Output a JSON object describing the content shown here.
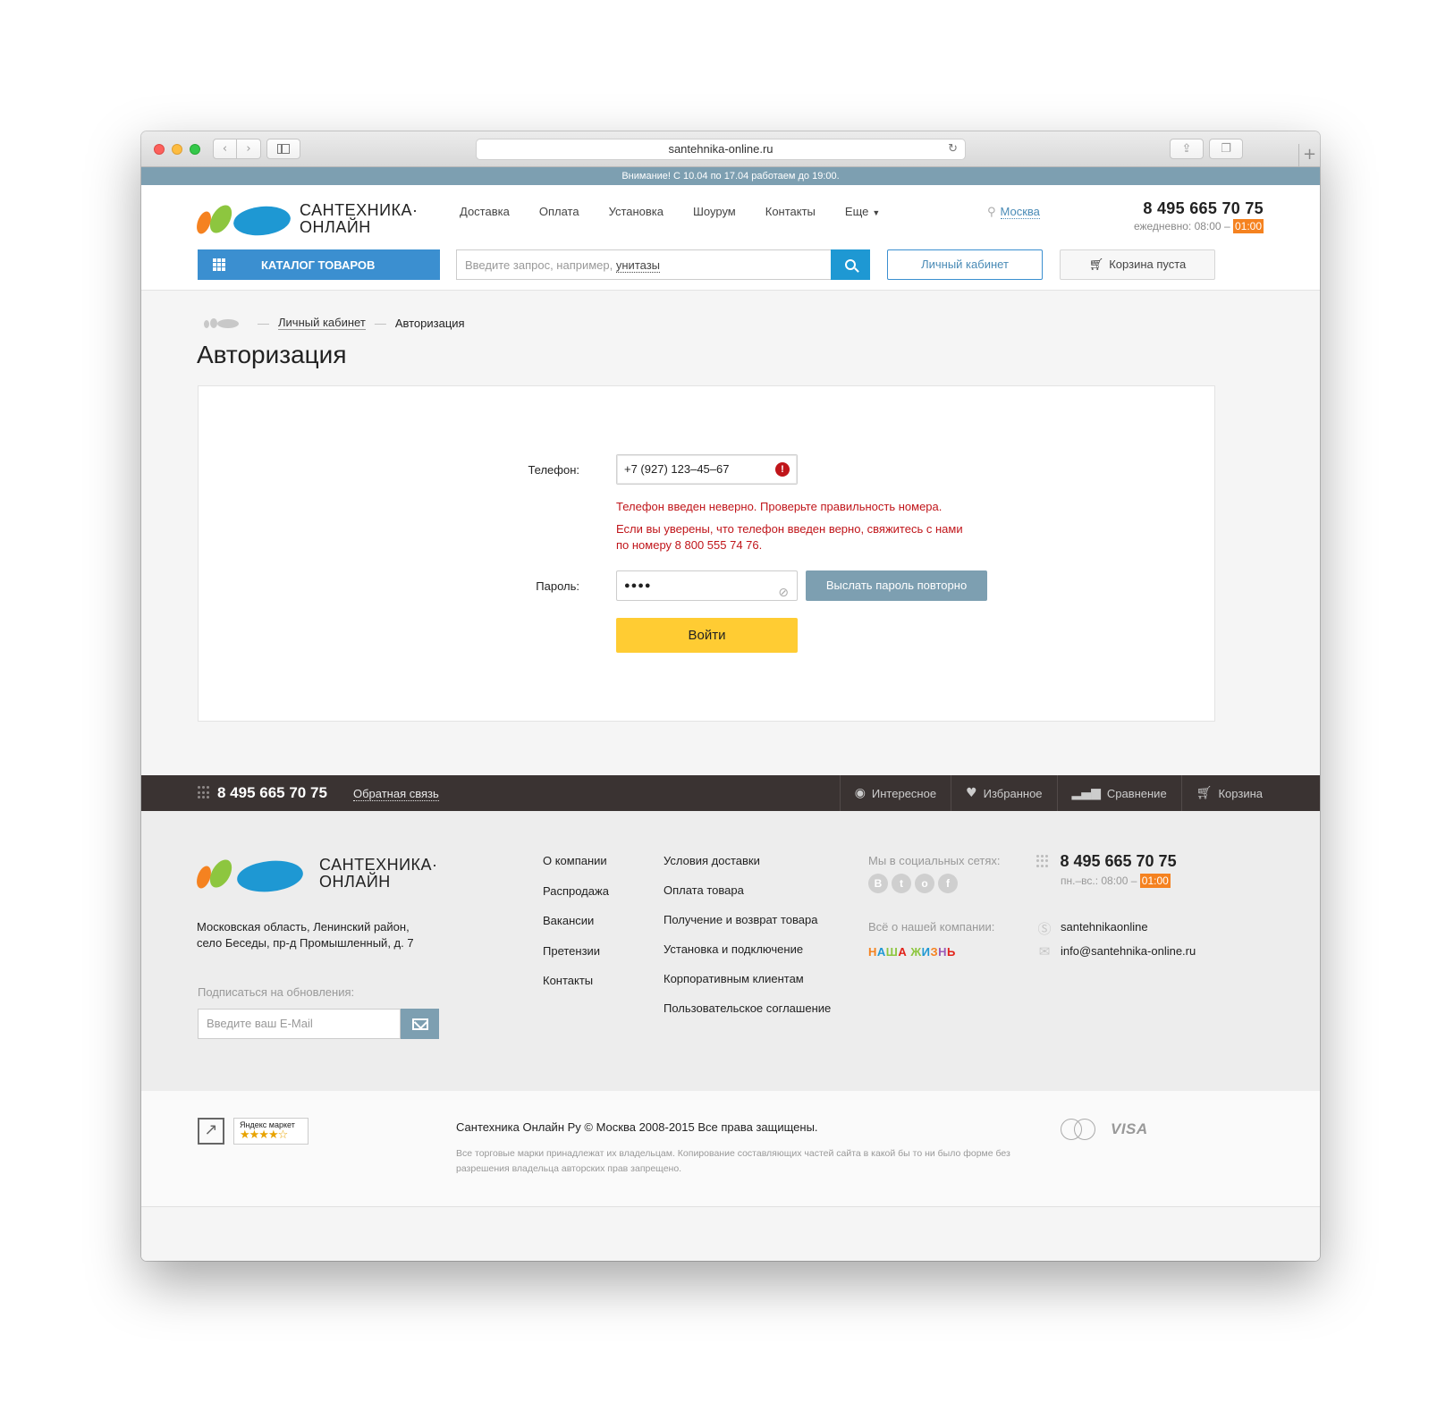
{
  "browser": {
    "url": "santehnika-online.ru"
  },
  "notice": "Внимание! С 10.04 по 17.04 работаем до 19:00.",
  "logo": {
    "line1": "САНТЕХНИКА·",
    "line2": "ОНЛАЙН"
  },
  "topnav": [
    {
      "label": "Доставка"
    },
    {
      "label": "Оплата"
    },
    {
      "label": "Установка"
    },
    {
      "label": "Шоурум"
    },
    {
      "label": "Контакты"
    },
    {
      "label": "Еще"
    }
  ],
  "city": "Москва",
  "header_contact": {
    "phone": "8 495 665 70 75",
    "hours_prefix": "ежедневно: 08:00 –",
    "hours_end": "01:00"
  },
  "catalog_button": "КАТАЛОГ ТОВАРОВ",
  "search": {
    "placeholder_prefix": "Введите запрос, например,",
    "placeholder_example": "унитазы"
  },
  "account_button": "Личный кабинет",
  "cart_button": "Корзина пуста",
  "breadcrumb": {
    "link": "Личный кабинет",
    "current": "Авторизация"
  },
  "page_title": "Авторизация",
  "login_form": {
    "phone_label": "Телефон:",
    "phone_value": "+7 (927) 123–45–67",
    "error_line1": "Телефон введен неверно. Проверьте правильность номера.",
    "error_line2": "Если вы уверены, что телефон введен верно, свяжитесь с нами",
    "error_line3": "по номеру 8 800 555 74 76.",
    "password_label": "Пароль:",
    "password_value": "●●●●",
    "resend_button": "Выслать пароль повторно",
    "login_button": "Войти"
  },
  "footbar": {
    "phone": "8 495 665 70 75",
    "feedback": "Обратная связь",
    "tabs": [
      {
        "label": "Интересное",
        "icon": "eye-icon"
      },
      {
        "label": "Избранное",
        "icon": "heart-icon"
      },
      {
        "label": "Сравнение",
        "icon": "bars-icon"
      },
      {
        "label": "Корзина",
        "icon": "cart-icon"
      }
    ]
  },
  "footer": {
    "address_line1": "Московская область, Ленинский район,",
    "address_line2": "село Беседы, пр-д Промышленный, д. 7",
    "subscribe_label": "Подписаться на обновления:",
    "subscribe_placeholder": "Введите ваш E-Mail",
    "col1": [
      "О компании",
      "Распродажа",
      "Вакансии",
      "Претензии",
      "Контакты"
    ],
    "col2": [
      "Условия доставки",
      "Оплата товара",
      "Получение и возврат товара",
      "Установка и подключение",
      "Корпоративным клиентам",
      "Пользовательское соглашение"
    ],
    "social_label": "Мы в социальных сетях:",
    "social_icons": [
      "В",
      "t",
      "о",
      "f"
    ],
    "about_label": "Всё о нашей компании:",
    "nasha_zhizn": "НАША ЖИЗНЬ",
    "phone": "8 495 665 70 75",
    "hours_prefix": "пн.–вс.: 08:00 –",
    "hours_end": "01:00",
    "skype": "santehnikaonline",
    "email": "info@santehnika-online.ru"
  },
  "bottom": {
    "ymarket_label": "Яндекс маркет",
    "ymarket_stars": "★★★★☆",
    "copyright": "Сантехника Онлайн Ру © Москва 2008-2015 Все права защищены.",
    "disclaimer": "Все торговые марки принадлежат их владельцам. Копирование составляющих частей сайта в какой бы то ни было форме без разрешения владельца авторских прав запрещено.",
    "mastercard": "MasterCard",
    "visa": "VISA"
  },
  "colors": {
    "notice_bg": "#7d9fb1",
    "primary_blue": "#3b8fd0",
    "error_red": "#c0151a",
    "login_yellow": "#ffcc33",
    "footbar_bg": "#3a3332",
    "hours_highlight": "#f58220"
  }
}
